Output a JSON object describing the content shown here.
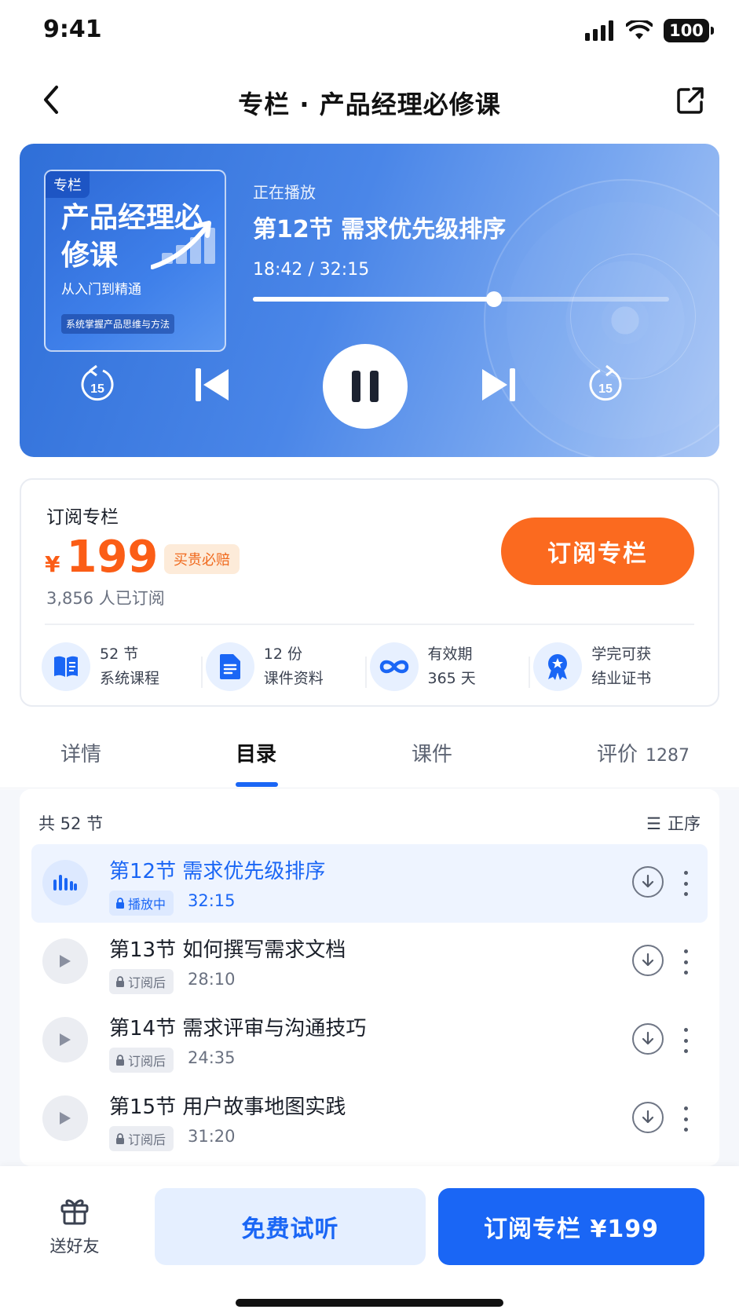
{
  "status_bar": {
    "time": "9:41",
    "battery": "100"
  },
  "nav": {
    "title": "专栏 · 产品经理必修课"
  },
  "player": {
    "cover": {
      "tag": "专栏",
      "title": "产品经理必修课",
      "subtitle": "从入门到精通",
      "desc": "系统掌握产品思维与方法"
    },
    "now_playing_label": "正在播放",
    "track_title": "第12节  需求优先级排序",
    "time_display": "18:42 / 32:15",
    "progress": 0.58,
    "rewind_seconds": "15",
    "forward_seconds": "15"
  },
  "subscribe": {
    "label": "订阅专栏",
    "currency": "¥",
    "price": "199",
    "badge": "买贵必赔",
    "subscribers": "3,856 人已订阅",
    "button": "订阅专栏",
    "features": [
      {
        "icon": "book-icon",
        "line1": "52 节",
        "line2": "系统课程"
      },
      {
        "icon": "document-icon",
        "line1": "12 份",
        "line2": "课件资料"
      },
      {
        "icon": "infinity-icon",
        "line1": "有效期",
        "line2": "365 天"
      },
      {
        "icon": "certificate-icon",
        "line1": "学完可获",
        "line2": "结业证书"
      }
    ]
  },
  "tabs": [
    {
      "label": "详情"
    },
    {
      "label": "目录",
      "active": true
    },
    {
      "label": "课件"
    },
    {
      "label": "评价",
      "count": "1287"
    }
  ],
  "catalog": {
    "count": "共 52 节",
    "sort": "正序",
    "items": [
      {
        "title": "第12节  需求优先级排序",
        "badge": "播放中",
        "duration": "32:15",
        "active": true
      },
      {
        "title": "第13节  如何撰写需求文档",
        "badge": "订阅后",
        "duration": "28:10"
      },
      {
        "title": "第14节  需求评审与沟通技巧",
        "badge": "订阅后",
        "duration": "24:35"
      },
      {
        "title": "第15节  用户故事地图实践",
        "badge": "订阅后",
        "duration": "31:20"
      }
    ]
  },
  "bottom_bar": {
    "gift_label": "送好友",
    "free_button": "免费试听",
    "buy_button": "订阅专栏 ¥199"
  },
  "colors": {
    "accent": "#1a66f5",
    "price": "#fb5d16",
    "subscribe_button": "#fb6a1f"
  }
}
